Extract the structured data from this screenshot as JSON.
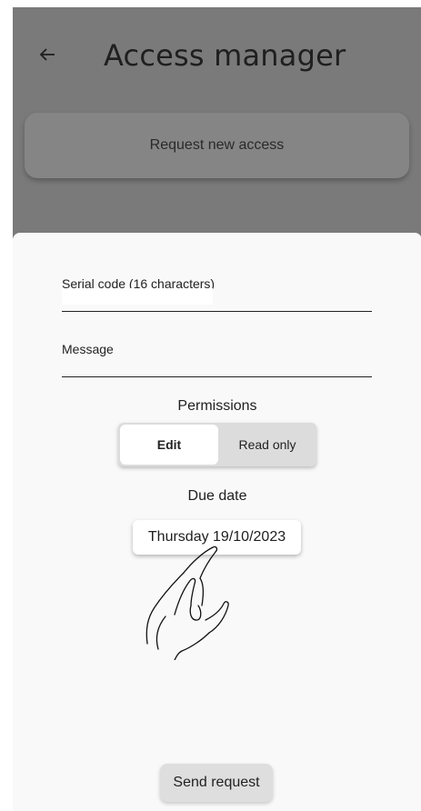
{
  "app_bar": {
    "back_icon": "arrow-left-icon",
    "title": "Access manager"
  },
  "main": {
    "request_card_label": "Request new access"
  },
  "sheet": {
    "serial_field": {
      "label": "Serial code (16 characters)",
      "value": ""
    },
    "message_field": {
      "label": "Message",
      "value": ""
    },
    "permissions": {
      "title": "Permissions",
      "options": [
        {
          "label": "Edit",
          "selected": true
        },
        {
          "label": "Read only",
          "selected": false
        }
      ]
    },
    "due_date": {
      "title": "Due date",
      "value": "Thursday 19/10/2023"
    },
    "gesture_icon": "pointing-hand-icon",
    "send_label": "Send request"
  },
  "colors": {
    "scrim": "#7a7a7a",
    "sheet_bg": "#f9f9f9",
    "toggle_bg": "#dcdcdc",
    "button_bg": "#dedede"
  }
}
